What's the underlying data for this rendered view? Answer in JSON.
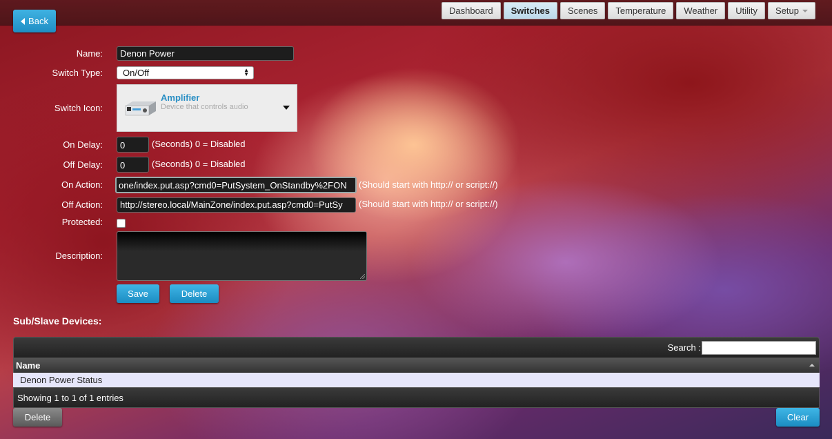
{
  "header": {
    "back_label": "Back",
    "tabs": [
      {
        "label": "Dashboard",
        "active": false
      },
      {
        "label": "Switches",
        "active": true
      },
      {
        "label": "Scenes",
        "active": false
      },
      {
        "label": "Temperature",
        "active": false
      },
      {
        "label": "Weather",
        "active": false
      },
      {
        "label": "Utility",
        "active": false
      },
      {
        "label": "Setup",
        "active": false
      }
    ]
  },
  "form": {
    "name_label": "Name:",
    "name_value": "Denon Power",
    "switch_type_label": "Switch Type:",
    "switch_type_value": "On/Off",
    "switch_icon_label": "Switch Icon:",
    "icon_title": "Amplifier",
    "icon_subtitle": "Device that controls audio",
    "on_delay_label": "On Delay:",
    "on_delay_value": "0",
    "off_delay_label": "Off Delay:",
    "off_delay_value": "0",
    "delay_hint": "(Seconds) 0 = Disabled",
    "on_action_label": "On Action:",
    "on_action_value": "one/index.put.asp?cmd0=PutSystem_OnStandby%2FON",
    "off_action_label": "Off Action:",
    "off_action_value": "http://stereo.local/MainZone/index.put.asp?cmd0=PutSy",
    "action_hint": "(Should start with http:// or script://)",
    "protected_label": "Protected:",
    "protected_checked": false,
    "description_label": "Description:",
    "description_value": "",
    "save_label": "Save",
    "delete_label": "Delete"
  },
  "subdevices": {
    "title": "Sub/Slave Devices:",
    "search_label": "Search :",
    "search_value": "",
    "column_name": "Name",
    "rows": [
      "Denon Power Status"
    ],
    "info": "Showing 1 to 1 of 1 entries",
    "delete_label": "Delete",
    "clear_label": "Clear"
  }
}
